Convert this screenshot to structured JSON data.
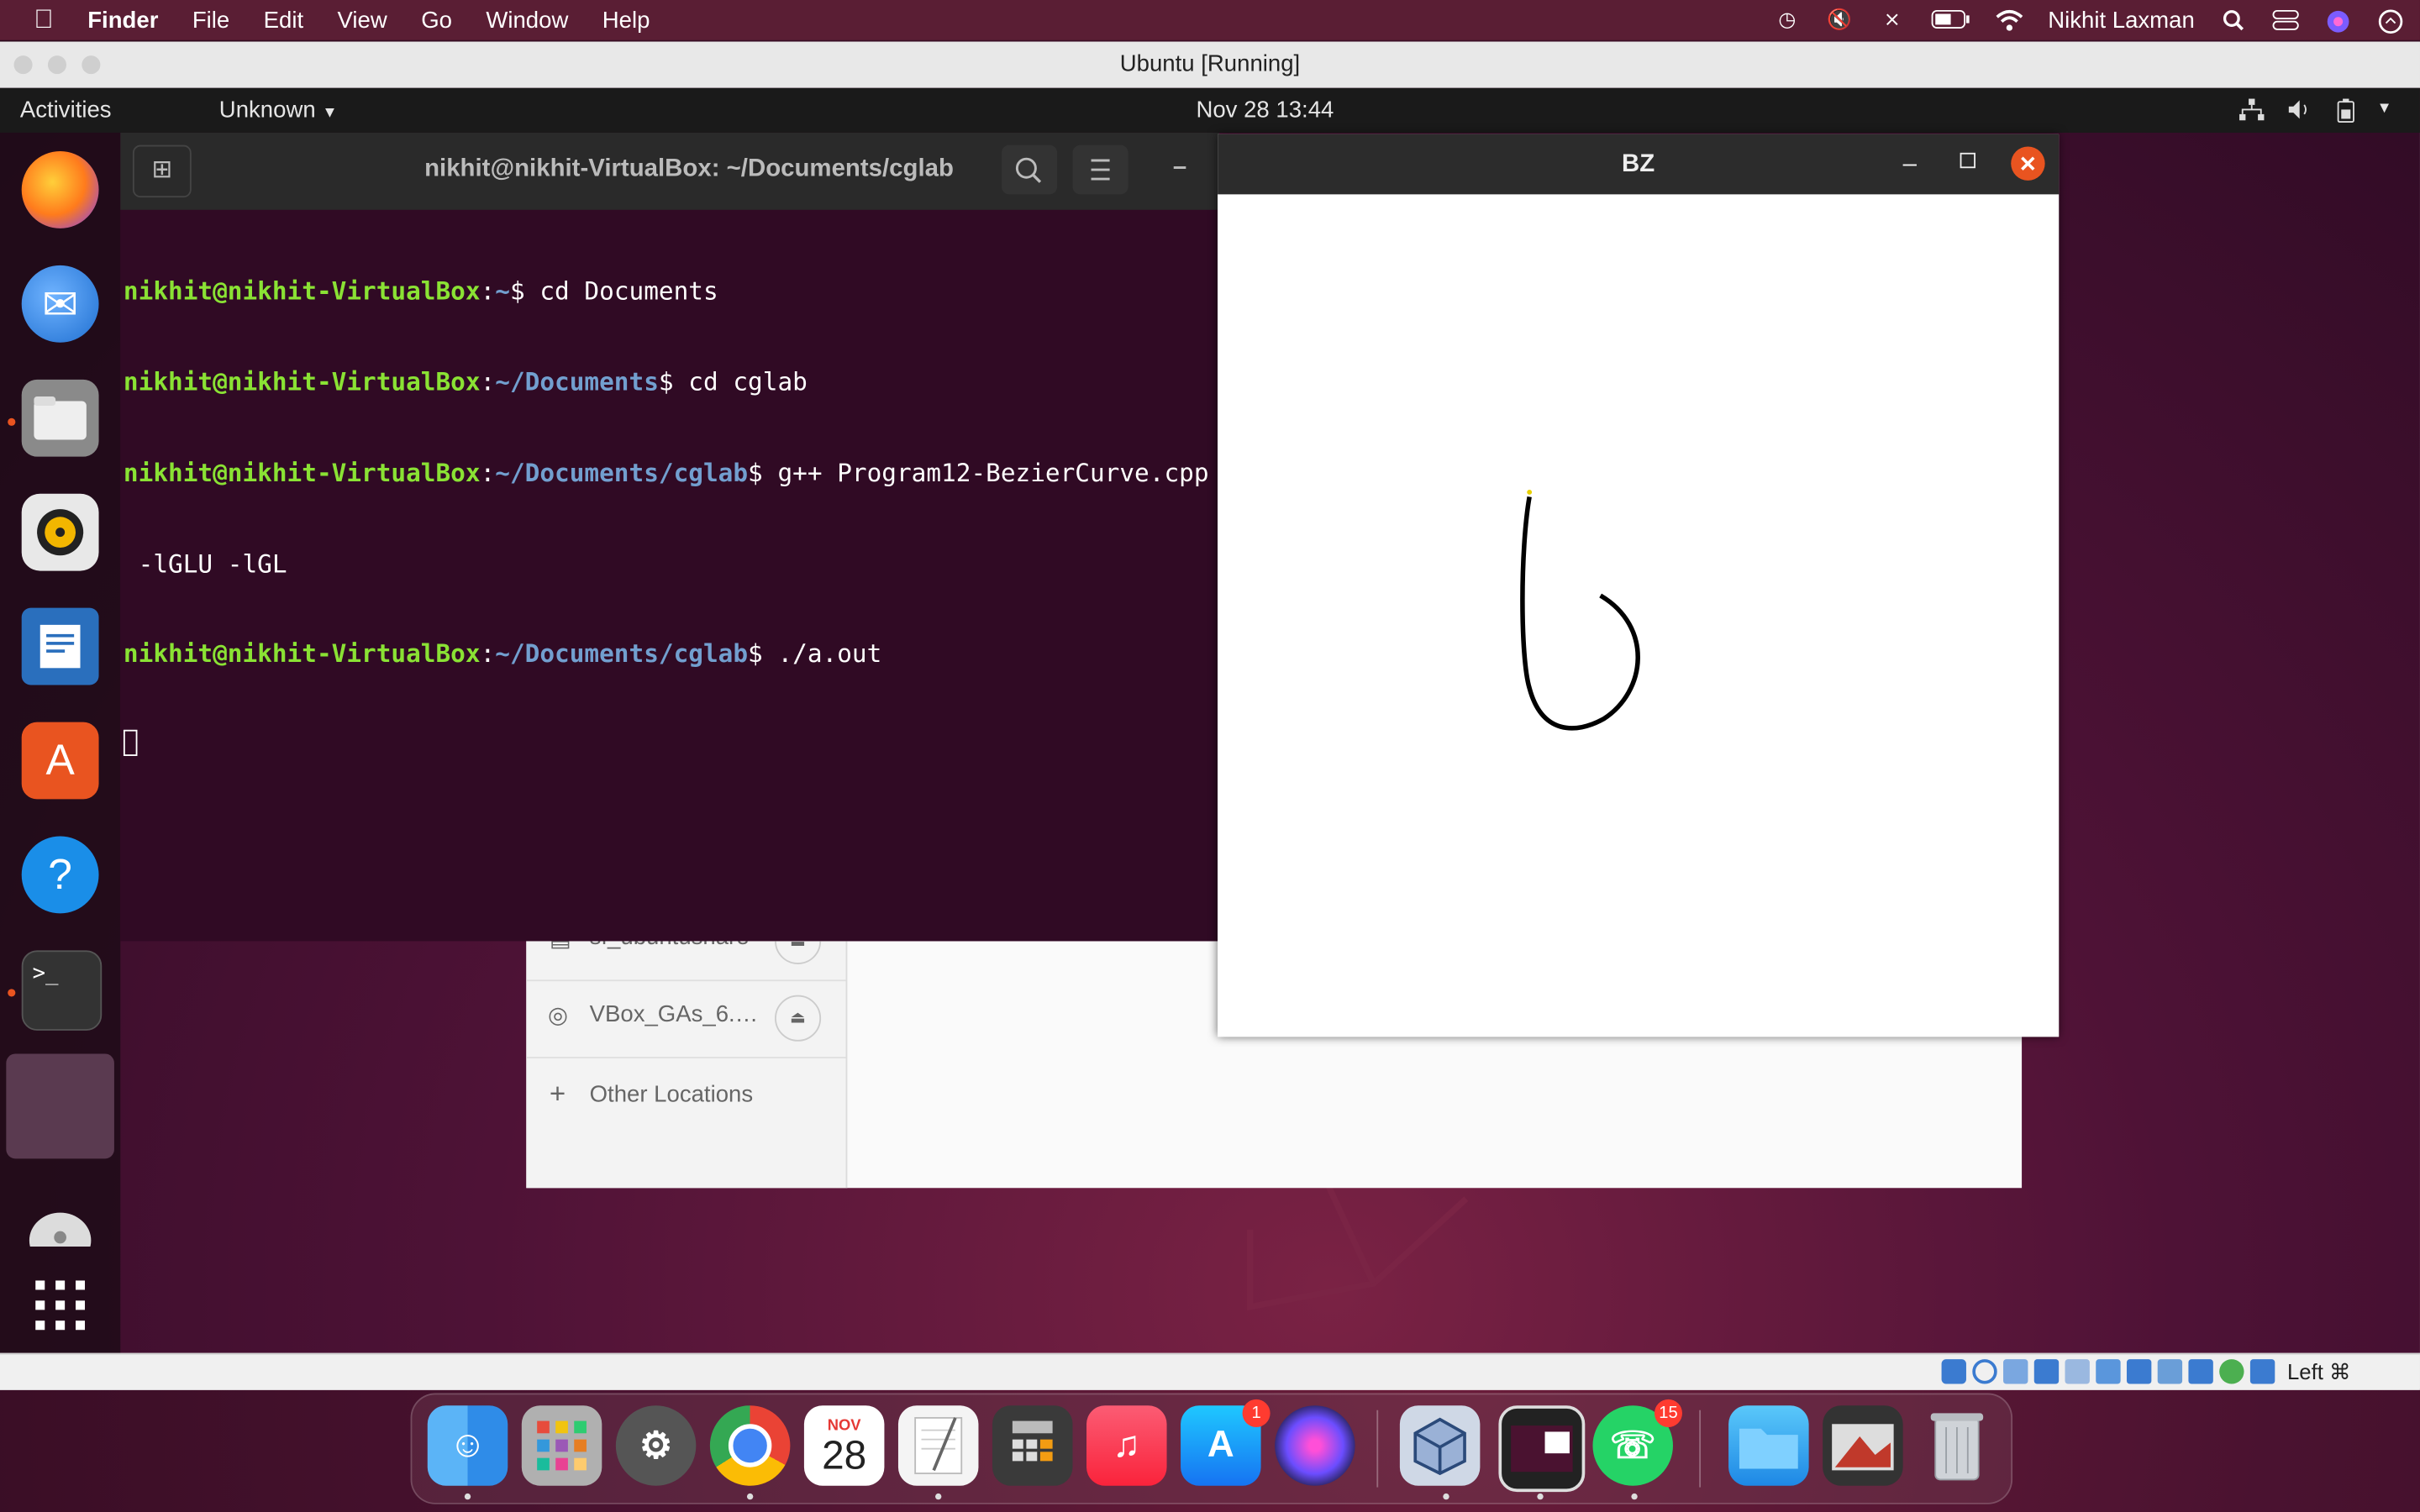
{
  "mac_menubar": {
    "app": "Finder",
    "items": [
      "File",
      "Edit",
      "View",
      "Go",
      "Window",
      "Help"
    ],
    "user": "Nikhit Laxman"
  },
  "vbox": {
    "title": "Ubuntu [Running]",
    "status_right": "Left ⌘"
  },
  "ubuntu_topbar": {
    "activities": "Activities",
    "app_menu": "Unknown",
    "clock": "Nov 28  13:44"
  },
  "terminal": {
    "title": "nikhit@nikhit-VirtualBox: ~/Documents/cglab",
    "lines": [
      {
        "user": "nikhit@nikhit-VirtualBox",
        "path": "~",
        "cmd": "$ cd Documents"
      },
      {
        "user": "nikhit@nikhit-VirtualBox",
        "path": "~/Documents",
        "cmd": "$ cd cglab"
      },
      {
        "user": "nikhit@nikhit-VirtualBox",
        "path": "~/Documents/cglab",
        "cmd": "$ g++ Program12-BezierCurve.cpp"
      },
      {
        "user": "",
        "path": "",
        "cmd": " -lGLU -lGL"
      },
      {
        "user": "nikhit@nikhit-VirtualBox",
        "path": "~/Documents/cglab",
        "cmd": "$ ./a.out"
      }
    ]
  },
  "files": {
    "sidebar": [
      "sf_ubuntushare",
      "VBox_GAs_6.…",
      "Other Locations"
    ]
  },
  "bz_window": {
    "title": "BZ"
  },
  "mac_dock": {
    "calendar_month": "NOV",
    "calendar_day": "28",
    "appstore_badge": "1",
    "whatsapp_badge": "15"
  }
}
